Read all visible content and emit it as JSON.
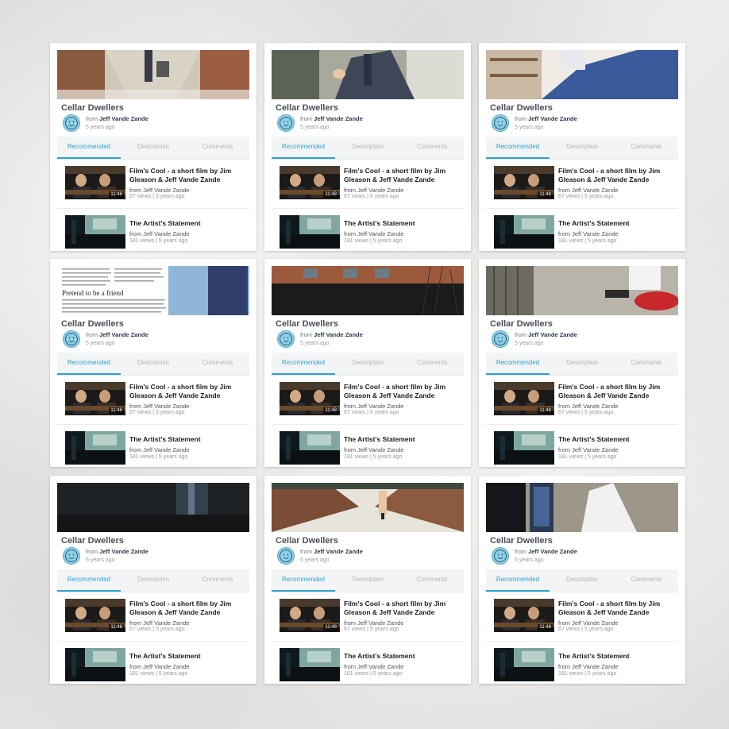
{
  "title": "Cellar Dwellers",
  "byline": {
    "prefix": "from",
    "author": "Jeff Vande Zande"
  },
  "age": "5 years ago",
  "tabs": [
    "Recommended",
    "Description",
    "Comments"
  ],
  "recommended": [
    {
      "title": "Film's Cool - a short film by Jim Gleason & Jeff Vande Zande",
      "from": "from Jeff Vande Zande",
      "stats": "67 views | 5 years ago",
      "duration": "11:48"
    },
    {
      "title": "The Artist's Statement",
      "from": "from Jeff Vande Zande",
      "stats": "181 views | 5 years ago",
      "duration": ""
    }
  ],
  "doc_thumb": {
    "heading": "Pretend to be a friend"
  },
  "colors": {
    "accent": "#2fa2cf",
    "avatar": "#8fd0ea",
    "card_bg": "#ffffff"
  }
}
